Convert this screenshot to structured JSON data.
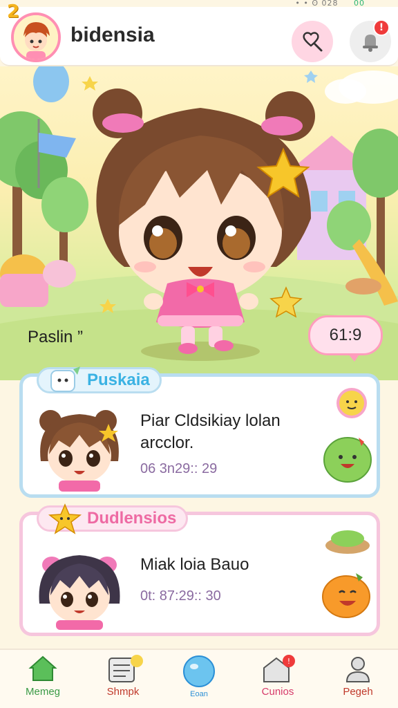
{
  "status_bar": {
    "text": "• • ʘ 028",
    "signal": "00"
  },
  "header": {
    "level": "2",
    "title": "bidensia",
    "notification_count": "!"
  },
  "hero": {
    "character_name": "Paslin ”",
    "stat": "61:9"
  },
  "cards": [
    {
      "tag": "Puskaia",
      "title": "Piar Cldsikiay lolan arcclor.",
      "time": "06 3n29:: 29"
    },
    {
      "tag": "Dudlensios",
      "title": "Miak loia Bauo",
      "time": "0t: 87:29:: 30"
    }
  ],
  "nav": {
    "items": [
      {
        "label": "Memeg",
        "color": "#3a9a46"
      },
      {
        "label": "Shmpk",
        "color": "#c0392b"
      },
      {
        "label": "Eoan",
        "color": "#2b8fd6"
      },
      {
        "label": "Cunios",
        "color": "#d63a6a"
      },
      {
        "label": "Pegeh",
        "color": "#c0392b"
      }
    ]
  },
  "colors": {
    "accent_pink": "#ff8fb3",
    "accent_blue": "#3ab2e3",
    "background": "#fdf6e3"
  }
}
